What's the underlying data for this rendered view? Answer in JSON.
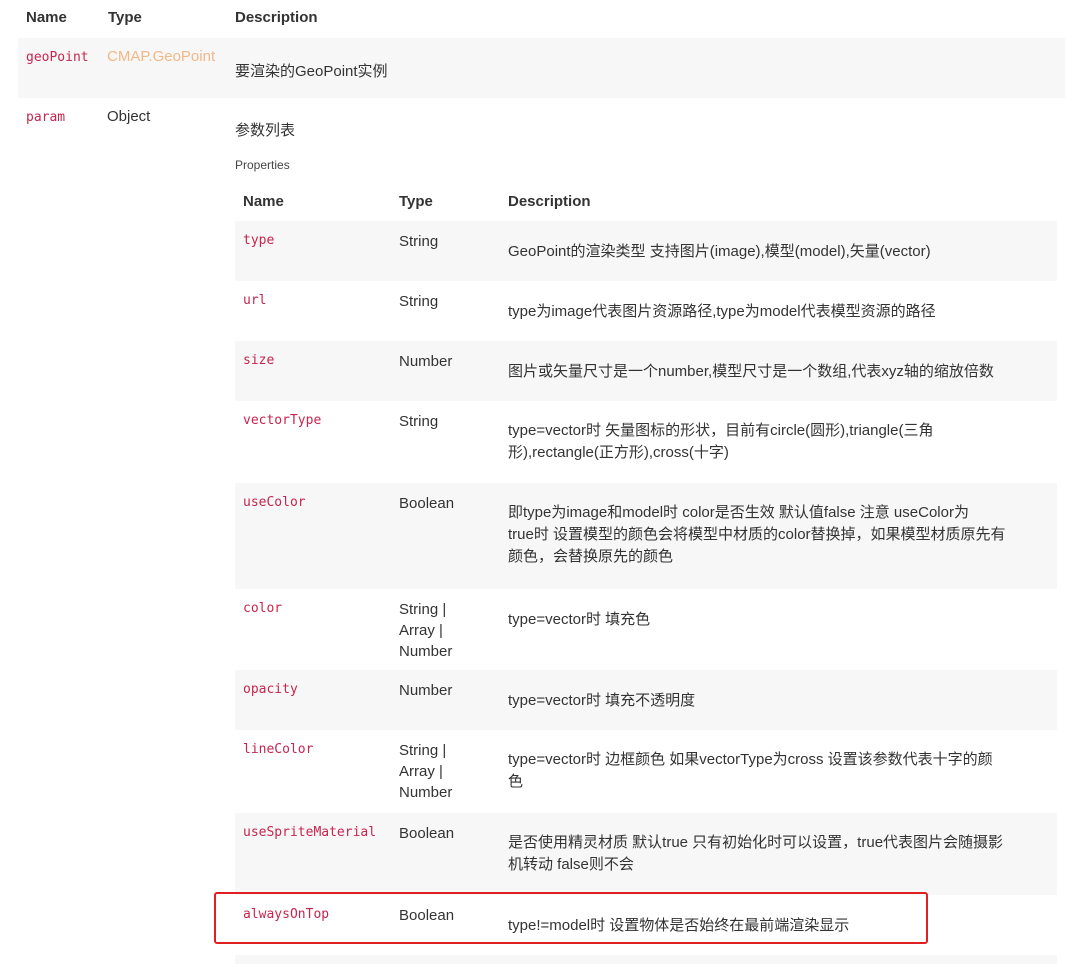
{
  "outer": {
    "headers": {
      "name": "Name",
      "type": "Type",
      "description": "Description"
    },
    "rows": [
      {
        "name": "geoPoint",
        "type": "CMAP.GeoPoint",
        "description": "要渲染的GeoPoint实例"
      },
      {
        "name": "param",
        "type": "Object",
        "description": "参数列表"
      }
    ],
    "properties_label": "Properties"
  },
  "inner": {
    "headers": {
      "name": "Name",
      "type": "Type",
      "description": "Description"
    },
    "rows": [
      {
        "name": "type",
        "type": "String",
        "description": "GeoPoint的渲染类型 支持图片(image),模型(model),矢量(vector)"
      },
      {
        "name": "url",
        "type": "String",
        "description": "type为image代表图片资源路径,type为model代表模型资源的路径"
      },
      {
        "name": "size",
        "type": "Number",
        "description": "图片或矢量尺寸是一个number,模型尺寸是一个数组,代表xyz轴的缩放倍数"
      },
      {
        "name": "vectorType",
        "type": "String",
        "description_lines": [
          "type=vector时 矢量图标的形状，目前有circle(圆形),triangle(三角",
          "形),rectangle(正方形),cross(十字)"
        ]
      },
      {
        "name": "useColor",
        "type": "Boolean",
        "description_lines": [
          "即type为image和model时 color是否生效 默认值false 注意 useColor为",
          "true时 设置模型的颜色会将模型中材质的color替换掉，如果模型材质原先有",
          "颜色，会替换原先的颜色"
        ]
      },
      {
        "name": "color",
        "type_lines": [
          "String |",
          "Array |",
          "Number"
        ],
        "description": "type=vector时 填充色"
      },
      {
        "name": "opacity",
        "type": "Number",
        "description": "type=vector时 填充不透明度"
      },
      {
        "name": "lineColor",
        "type_lines": [
          "String |",
          "Array |",
          "Number"
        ],
        "description_lines": [
          "type=vector时 边框颜色 如果vectorType为cross 设置该参数代表十字的颜",
          "色"
        ]
      },
      {
        "name": "useSpriteMaterial",
        "type": "Boolean",
        "description_lines": [
          "是否使用精灵材质 默认true 只有初始化时可以设置，true代表图片会随摄影",
          "机转动 false则不会"
        ]
      },
      {
        "name": "alwaysOnTop",
        "type": "Boolean",
        "description": "type!=model时 设置物体是否始终在最前端渲染显示"
      }
    ]
  },
  "colors": {
    "param_name": "#c7254e",
    "type_link": "#f3b887",
    "row_shade": "#f7f7f7",
    "highlight_border": "#e02020"
  }
}
